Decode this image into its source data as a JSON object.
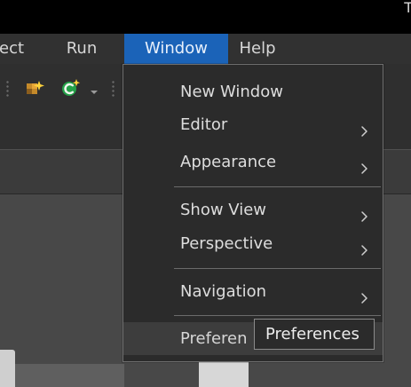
{
  "window": {
    "title_fragment": "T"
  },
  "menubar": {
    "items": [
      {
        "label": "ect",
        "state": "normal"
      },
      {
        "label": "Run",
        "state": "normal"
      },
      {
        "label": "Window",
        "state": "active"
      },
      {
        "label": "Help",
        "state": "normal"
      }
    ]
  },
  "toolbar": {
    "icons": [
      {
        "name": "wizard-icon"
      },
      {
        "name": "new-class-icon"
      },
      {
        "name": "dropdown-arrow-icon"
      }
    ]
  },
  "window_menu": {
    "items": [
      {
        "label": "New Window",
        "submenu": false
      },
      {
        "label": "Editor",
        "submenu": true
      },
      {
        "label": "Appearance",
        "submenu": true
      },
      {
        "label": "Show View",
        "submenu": true
      },
      {
        "label": "Perspective",
        "submenu": true
      },
      {
        "label": "Navigation",
        "submenu": true
      },
      {
        "label": "Preferen",
        "submenu": false,
        "state": "hover"
      }
    ]
  },
  "tooltip": {
    "text": "Preferences"
  },
  "colors": {
    "menu_active": "#1b63b8",
    "menu_bg": "#2b2b2b",
    "menu_border": "#6f6f6f",
    "text": "#dddddd"
  }
}
